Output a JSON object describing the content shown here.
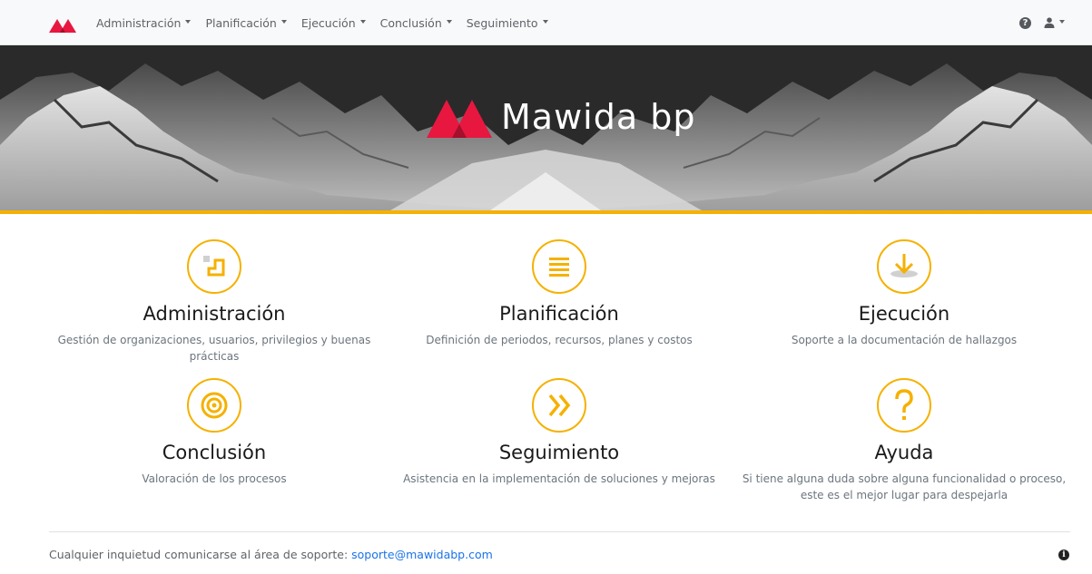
{
  "navbar": {
    "brand_color": "#e8173f",
    "items": [
      {
        "label": "Administración"
      },
      {
        "label": "Planificación"
      },
      {
        "label": "Ejecución"
      },
      {
        "label": "Conclusión"
      },
      {
        "label": "Seguimiento"
      }
    ],
    "help_icon": "question-circle-icon",
    "user_icon": "user-icon"
  },
  "hero": {
    "title": "Mawida bp",
    "accent_color": "#f5b100"
  },
  "features": [
    {
      "title": "Administración",
      "description": "Gestión de organizaciones, usuarios, privilegios y buenas prácticas",
      "icon": "admin-steps-icon"
    },
    {
      "title": "Planificación",
      "description": "Definición de periodos, recursos, planes y costos",
      "icon": "list-icon"
    },
    {
      "title": "Ejecución",
      "description": "Soporte a la documentación de hallazgos",
      "icon": "download-icon"
    },
    {
      "title": "Conclusión",
      "description": "Valoración de los procesos",
      "icon": "target-icon"
    },
    {
      "title": "Seguimiento",
      "description": "Asistencia en la implementación de soluciones y mejoras",
      "icon": "double-chevron-right-icon"
    },
    {
      "title": "Ayuda",
      "description": "Si tiene alguna duda sobre alguna funcionalidad o proceso, este es el mejor lugar para despejarla",
      "icon": "question-icon"
    }
  ],
  "footer": {
    "text": "Cualquier inquietud comunicarse al área de soporte: ",
    "email": "soporte@mawidabp.com",
    "info_icon": "info-icon"
  }
}
